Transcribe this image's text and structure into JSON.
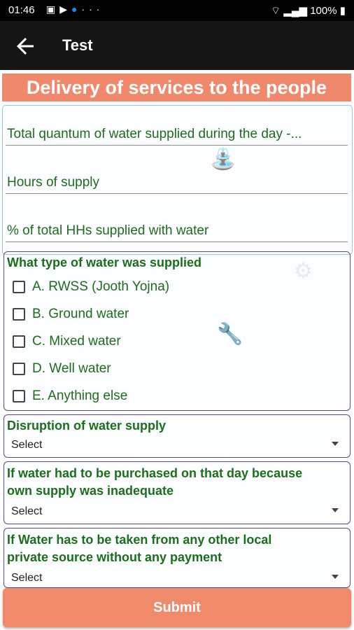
{
  "status_bar": {
    "time": "01:46",
    "battery": "100%",
    "icon_names": [
      "image-icon",
      "play-icon",
      "vpn-dot-icon",
      "more-dots-icon",
      "wifi-icon",
      "signal-icon",
      "battery-icon"
    ]
  },
  "app_bar": {
    "title": "Test"
  },
  "form": {
    "header": "Delivery of services to the people",
    "fields": [
      "Total quantum of water supplied during the day -...",
      "Hours of supply",
      "% of total HHs supplied with water"
    ],
    "water_type": {
      "label": "What type of water was supplied",
      "options": [
        "A. RWSS (Jooth Yojna)",
        "B. Ground water",
        "C. Mixed water",
        "D. Well water",
        "E. Anything else"
      ]
    },
    "disruption": {
      "label": "Disruption of water supply",
      "value": "Select"
    },
    "purchased": {
      "label_line1": "If water had to be purchased on that day because",
      "label_line2": "own supply was inadequate",
      "value": "Select"
    },
    "local_source": {
      "label_line1": "If Water has to be taken from any other local",
      "label_line2": "private source without any payment",
      "value": "Select"
    },
    "submit_label": "Submit"
  },
  "colors": {
    "accent": "#f0896c",
    "label_green": "#1b6e1b",
    "section_border": "#5e4a82",
    "app_bar": "#161616"
  }
}
